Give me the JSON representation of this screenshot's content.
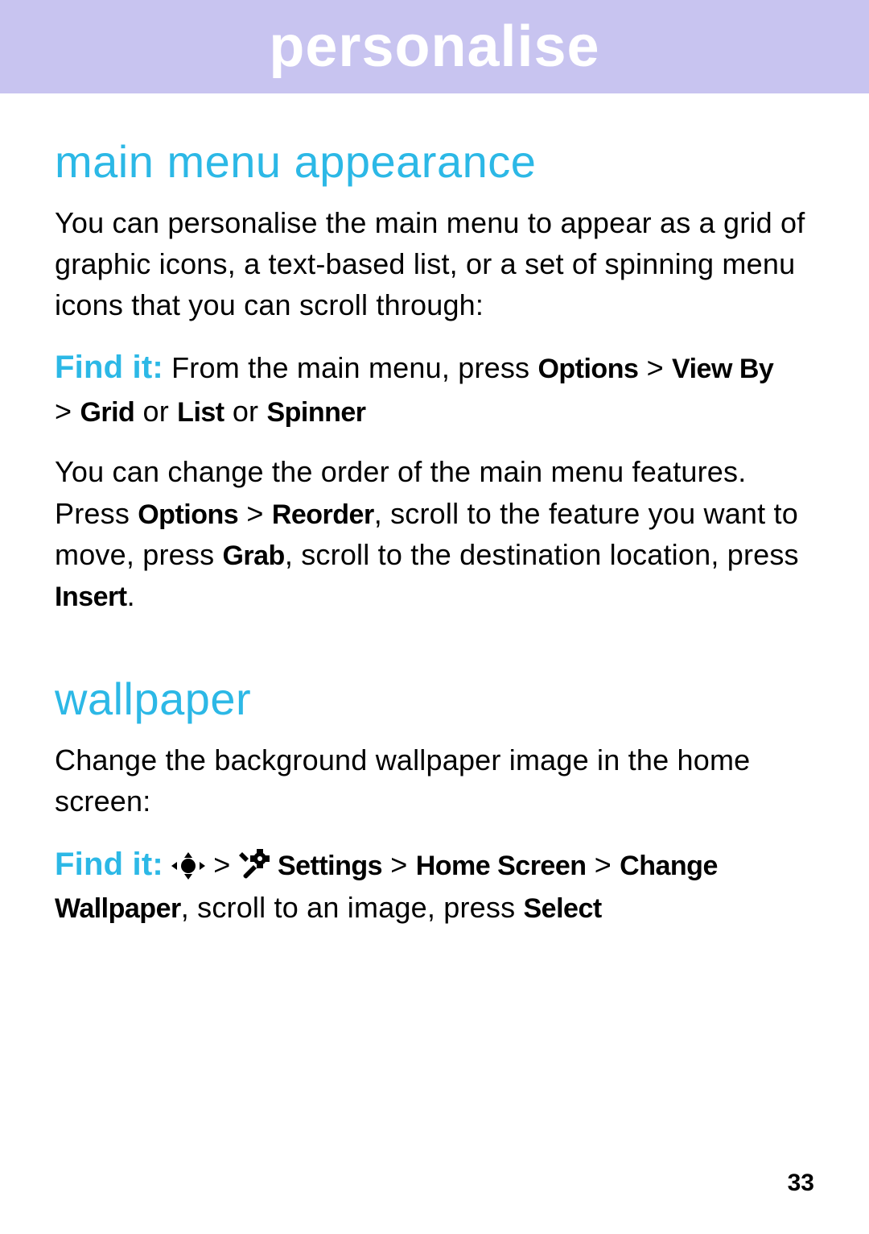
{
  "header": {
    "title": "personalise"
  },
  "section1": {
    "title": "main menu appearance",
    "para1": "You can personalise the main menu to appear as a grid of graphic icons, a text-based list, or a set of spinning menu icons that you can scroll through:",
    "findit_label": "Find it:",
    "findit_line1_a": " From the main menu, press ",
    "opt_options": "Options",
    "gt": " > ",
    "opt_viewby": "View By",
    "opt_grid": "Grid",
    "or": " or ",
    "opt_list": "List",
    "opt_spinner": "Spinner",
    "para2_a": "You can change the order of the main menu features. Press ",
    "para2_b": ", scroll to the feature you want to move, press ",
    "opt_reorder": "Reorder",
    "opt_grab": "Grab",
    "para2_c": ", scroll to the destination location, press ",
    "opt_insert": "Insert",
    "period": "."
  },
  "section2": {
    "title": "wallpaper",
    "para1": "Change the background wallpaper image in the home screen:",
    "findit_label": "Find it:",
    "gt": " > ",
    "opt_settings": "Settings",
    "opt_home": "Home Screen",
    "opt_change": "Change Wallpaper",
    "comma": ", ",
    "tail_a": "scroll to an image, press ",
    "opt_select": "Select"
  },
  "page_number": "33",
  "icons": {
    "nav": "nav-key-icon",
    "settings": "settings-tools-icon"
  }
}
